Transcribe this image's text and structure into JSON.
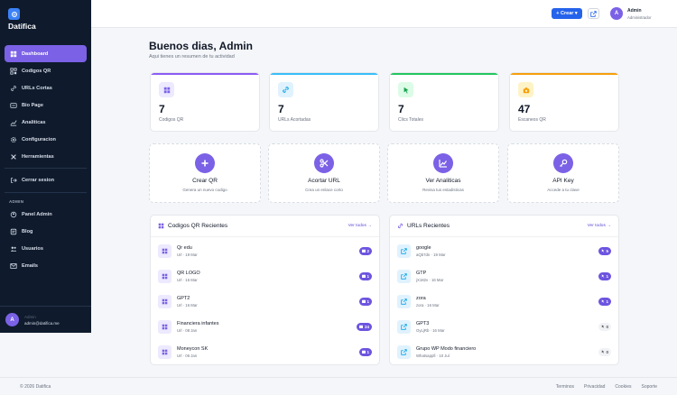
{
  "brand": {
    "name": "Datifica"
  },
  "sidebar": {
    "items": [
      {
        "label": "Dashboard",
        "icon": "dashboard-icon",
        "active": true
      },
      {
        "label": "Codigos QR",
        "icon": "qr-icon"
      },
      {
        "label": "URLs Cortas",
        "icon": "link-icon"
      },
      {
        "label": "Bio Page",
        "icon": "page-icon"
      },
      {
        "label": "Analiticas",
        "icon": "chart-icon"
      },
      {
        "label": "Configuracion",
        "icon": "gear-icon"
      },
      {
        "label": "Herramientas",
        "icon": "tools-icon"
      },
      {
        "label": "Cerrar sesion",
        "icon": "logout-icon"
      }
    ],
    "admin_section": "ADMIN",
    "admin_items": [
      {
        "label": "Panel Admin",
        "icon": "panel-icon"
      },
      {
        "label": "Blog",
        "icon": "blog-icon"
      },
      {
        "label": "Usuarios",
        "icon": "users-icon"
      },
      {
        "label": "Emails",
        "icon": "mail-icon"
      }
    ],
    "user": {
      "initial": "A",
      "name": "Admin",
      "email": "admin@datifica.me"
    }
  },
  "header": {
    "create_label": "+ Crear ▾",
    "user_initial": "A",
    "user_name": "Admin",
    "user_role": "Administrador"
  },
  "main": {
    "title": "Buenos dias, Admin",
    "subtitle": "Aqui tienes un resumen de tu actividad",
    "stats": [
      {
        "value": "7",
        "label": "Codigos QR",
        "color": "#8b5cf6",
        "icon": "qr-icon"
      },
      {
        "value": "7",
        "label": "URLs Acortadas",
        "color": "#38bdf8",
        "icon": "link-icon"
      },
      {
        "value": "7",
        "label": "Clics Totales",
        "color": "#22c55e",
        "icon": "cursor-icon"
      },
      {
        "value": "47",
        "label": "Escaneos QR",
        "color": "#f59e0b",
        "icon": "camera-icon"
      }
    ],
    "actions": [
      {
        "title": "Crear QR",
        "desc": "Genera un nuevo codigo",
        "icon": "plus-icon"
      },
      {
        "title": "Acortar URL",
        "desc": "Crea un enlace corto",
        "icon": "scissors-icon"
      },
      {
        "title": "Ver Analiticas",
        "desc": "Revisa tus estadisticas",
        "icon": "chart-icon"
      },
      {
        "title": "API Key",
        "desc": "Accede a tu clave",
        "icon": "key-icon"
      }
    ],
    "qr_panel": {
      "title": "Codigos QR Recientes",
      "link": "Ver todos →",
      "rows": [
        {
          "name": "Qr edu",
          "meta": "Url · 19 Mar",
          "count": "2",
          "filled": true
        },
        {
          "name": "QR LOGO",
          "meta": "Url · 16 Mar",
          "count": "1",
          "filled": true
        },
        {
          "name": "GPT2",
          "meta": "Url · 16 Mar",
          "count": "1",
          "filled": true
        },
        {
          "name": "Financiera infantes",
          "meta": "Url · 08 Jan",
          "count": "24",
          "filled": true
        },
        {
          "name": "Moneycon SK",
          "meta": "Url · 06 Jan",
          "count": "1",
          "filled": true
        }
      ]
    },
    "url_panel": {
      "title": "URLs Recientes",
      "link": "Ver todos →",
      "rows": [
        {
          "name": "google",
          "meta": "aQb7dn · 19 Mar",
          "count": "5",
          "filled": true
        },
        {
          "name": "GTP",
          "meta": "jX182v · 16 Mar",
          "count": "1",
          "filled": true
        },
        {
          "name": "zora",
          "meta": "zora · 16 Mar",
          "count": "1",
          "filled": true
        },
        {
          "name": "GPT3",
          "meta": "OyLjRb · 16 Mar",
          "count": "0",
          "filled": false
        },
        {
          "name": "Grupo WP Modo financiero",
          "meta": "Whatsappfi · 10 Jul",
          "count": "0",
          "filled": false
        }
      ]
    }
  },
  "footer": {
    "copyright": "© 2026 Datifica",
    "links": [
      "Terminos",
      "Privacidad",
      "Cookies",
      "Soporte"
    ]
  },
  "colors": {
    "accent": "#7b61e6",
    "sidebar_bg": "#0f1b2d",
    "primary": "#2563eb"
  }
}
